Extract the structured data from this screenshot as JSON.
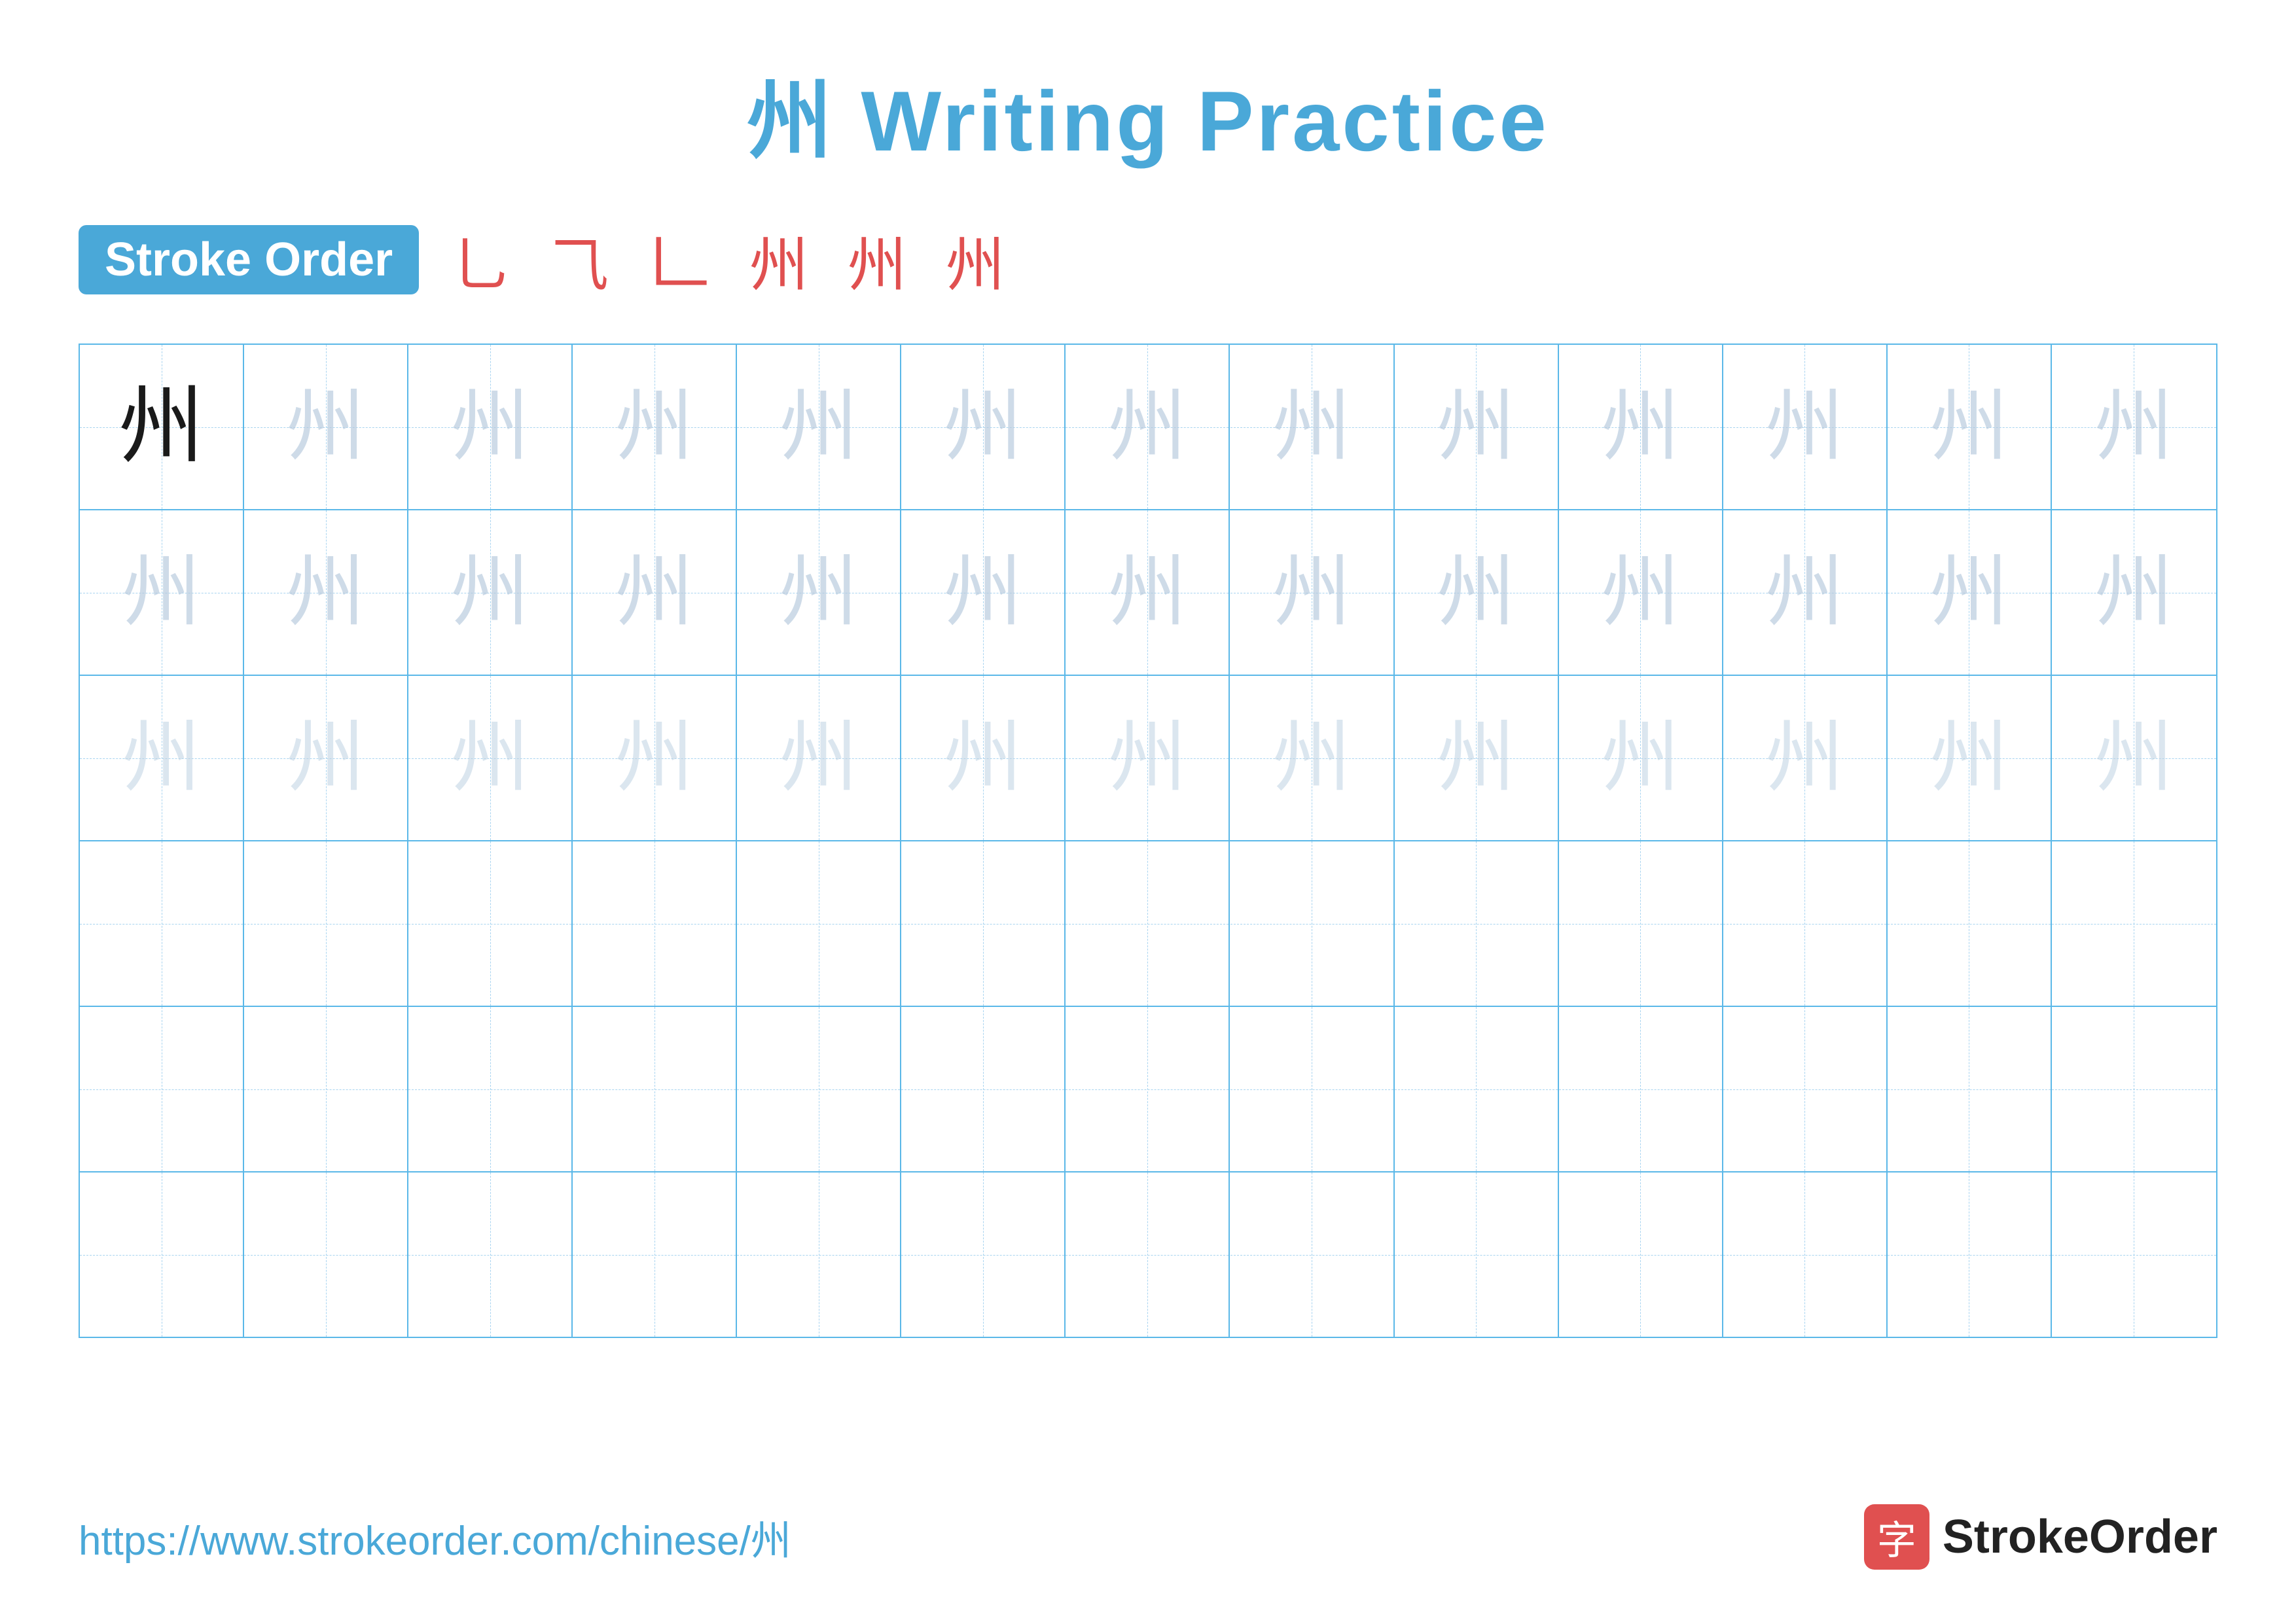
{
  "title": {
    "char": "州",
    "text": "Writing Practice",
    "full": "州 Writing Practice"
  },
  "stroke_order": {
    "badge_label": "Stroke Order",
    "steps": [
      "丶",
      "𠃌",
      "𰁓",
      "州",
      "州",
      "州"
    ]
  },
  "grid": {
    "rows": 6,
    "cols": 13,
    "char": "州",
    "row1_solid": true,
    "row1_faint_count": 12,
    "row2_faint_count": 13,
    "row3_faint_count": 13,
    "empty_rows": 3
  },
  "footer": {
    "url": "https://www.strokeorder.com/chinese/州",
    "logo_char": "字",
    "logo_text": "StrokeOrder"
  }
}
